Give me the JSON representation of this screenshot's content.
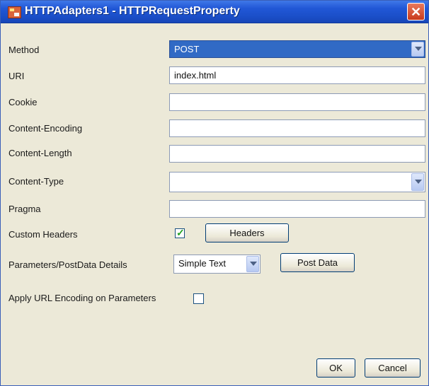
{
  "window": {
    "title": "HTTPAdapters1 - HTTPRequestProperty",
    "close_glyph": "✕",
    "icon": "app-icon"
  },
  "form": {
    "method": {
      "label": "Method",
      "value": "POST"
    },
    "uri": {
      "label": "URI",
      "value": "index.html"
    },
    "cookie": {
      "label": "Cookie",
      "value": ""
    },
    "content_encoding": {
      "label": "Content-Encoding",
      "value": ""
    },
    "content_length": {
      "label": "Content-Length",
      "value": ""
    },
    "content_type": {
      "label": "Content-Type",
      "value": ""
    },
    "pragma": {
      "label": "Pragma",
      "value": ""
    },
    "custom_headers": {
      "label": "Custom Headers",
      "checked": true,
      "button": "Headers"
    },
    "params": {
      "label": "Parameters/PostData Details",
      "value": "Simple Text",
      "button": "Post Data"
    },
    "url_encoding": {
      "label": "Apply URL Encoding on Parameters",
      "checked": false
    }
  },
  "footer": {
    "ok": "OK",
    "cancel": "Cancel"
  },
  "colors": {
    "titlebar": "#1b4fc9",
    "selection": "#316ac5",
    "dialog_bg": "#ece9d8"
  }
}
